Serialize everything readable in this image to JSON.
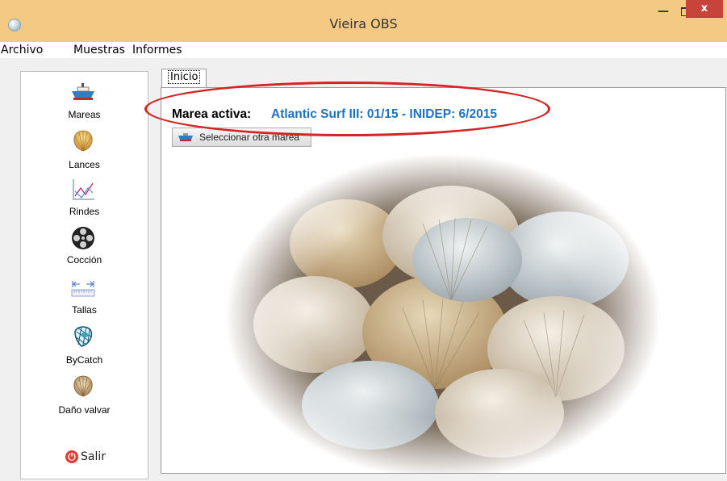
{
  "window": {
    "title": "Vieira OBS",
    "minimize_label": "—",
    "close_label": "x"
  },
  "menu": [
    "Archivo",
    "Muestras",
    "Informes"
  ],
  "sidebar": {
    "items": [
      {
        "label": "Mareas",
        "icon": "ship-icon"
      },
      {
        "label": "Lances",
        "icon": "scallop-shell-icon"
      },
      {
        "label": "Rindes",
        "icon": "line-chart-icon"
      },
      {
        "label": "Cocción",
        "icon": "film-reel-icon"
      },
      {
        "label": "Tallas",
        "icon": "ruler-icon"
      },
      {
        "label": "ByCatch",
        "icon": "fish-net-icon"
      },
      {
        "label": "Daño valvar",
        "icon": "scallop-shell-icon"
      }
    ],
    "salir_label": "Salir",
    "salir_icon": "power-icon"
  },
  "tabs": [
    {
      "label": "Inicio"
    }
  ],
  "main": {
    "marea_label": "Marea activa:",
    "marea_value": "Atlantic Surf III: 01/15 - INIDEP: 6/2015",
    "select_button": "Seleccionar otra marea",
    "photo_icon": "scallop-shells-photo"
  },
  "colors": {
    "titlebar": "#f3c983",
    "close": "#c7443b",
    "accent": "#1e73be",
    "highlight": "#d42424"
  }
}
